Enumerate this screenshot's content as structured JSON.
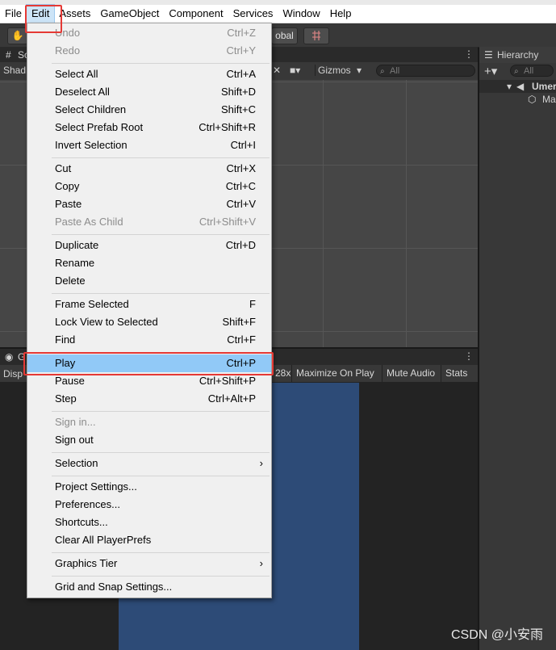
{
  "menubar": {
    "items": [
      "File",
      "Edit",
      "Assets",
      "GameObject",
      "Component",
      "Services",
      "Window",
      "Help"
    ]
  },
  "toolbar": {
    "global_label": "obal"
  },
  "scene": {
    "tab_label": "Sc",
    "shading_label": "Shad",
    "gizmos_label": "Gizmos",
    "search_placeholder": "All"
  },
  "game": {
    "tab_label": "G",
    "display_label": "Disp",
    "scale_label": "28x",
    "maximize_label": "Maximize On Play",
    "mute_label": "Mute Audio",
    "stats_label": "Stats"
  },
  "hierarchy": {
    "tab_label": "Hierarchy",
    "search_placeholder": "All",
    "scene_item": "Umer",
    "child_item": "Ma"
  },
  "edit_menu": {
    "items": [
      {
        "label": "Undo",
        "shortcut": "Ctrl+Z",
        "disabled": true
      },
      {
        "label": "Redo",
        "shortcut": "Ctrl+Y",
        "disabled": true
      },
      {
        "label": "Select All",
        "shortcut": "Ctrl+A"
      },
      {
        "label": "Deselect All",
        "shortcut": "Shift+D"
      },
      {
        "label": "Select Children",
        "shortcut": "Shift+C"
      },
      {
        "label": "Select Prefab Root",
        "shortcut": "Ctrl+Shift+R"
      },
      {
        "label": "Invert Selection",
        "shortcut": "Ctrl+I"
      },
      {
        "label": "Cut",
        "shortcut": "Ctrl+X"
      },
      {
        "label": "Copy",
        "shortcut": "Ctrl+C"
      },
      {
        "label": "Paste",
        "shortcut": "Ctrl+V"
      },
      {
        "label": "Paste As Child",
        "shortcut": "Ctrl+Shift+V",
        "disabled": true
      },
      {
        "label": "Duplicate",
        "shortcut": "Ctrl+D"
      },
      {
        "label": "Rename",
        "shortcut": ""
      },
      {
        "label": "Delete",
        "shortcut": ""
      },
      {
        "label": "Frame Selected",
        "shortcut": "F"
      },
      {
        "label": "Lock View to Selected",
        "shortcut": "Shift+F"
      },
      {
        "label": "Find",
        "shortcut": "Ctrl+F"
      },
      {
        "label": "Play",
        "shortcut": "Ctrl+P",
        "selected": true
      },
      {
        "label": "Pause",
        "shortcut": "Ctrl+Shift+P"
      },
      {
        "label": "Step",
        "shortcut": "Ctrl+Alt+P"
      },
      {
        "label": "Sign in...",
        "shortcut": "",
        "disabled": true
      },
      {
        "label": "Sign out",
        "shortcut": ""
      },
      {
        "label": "Selection",
        "shortcut": "",
        "submenu": true
      },
      {
        "label": "Project Settings...",
        "shortcut": ""
      },
      {
        "label": "Preferences...",
        "shortcut": ""
      },
      {
        "label": "Shortcuts...",
        "shortcut": ""
      },
      {
        "label": "Clear All PlayerPrefs",
        "shortcut": ""
      },
      {
        "label": "Graphics Tier",
        "shortcut": "",
        "submenu": true
      },
      {
        "label": "Grid and Snap Settings...",
        "shortcut": ""
      }
    ]
  },
  "watermark": "CSDN @小安雨",
  "colors": {
    "highlight_box": "#e53935",
    "menu_selected": "#91c9f7",
    "game_screen": "#2d4b77"
  }
}
